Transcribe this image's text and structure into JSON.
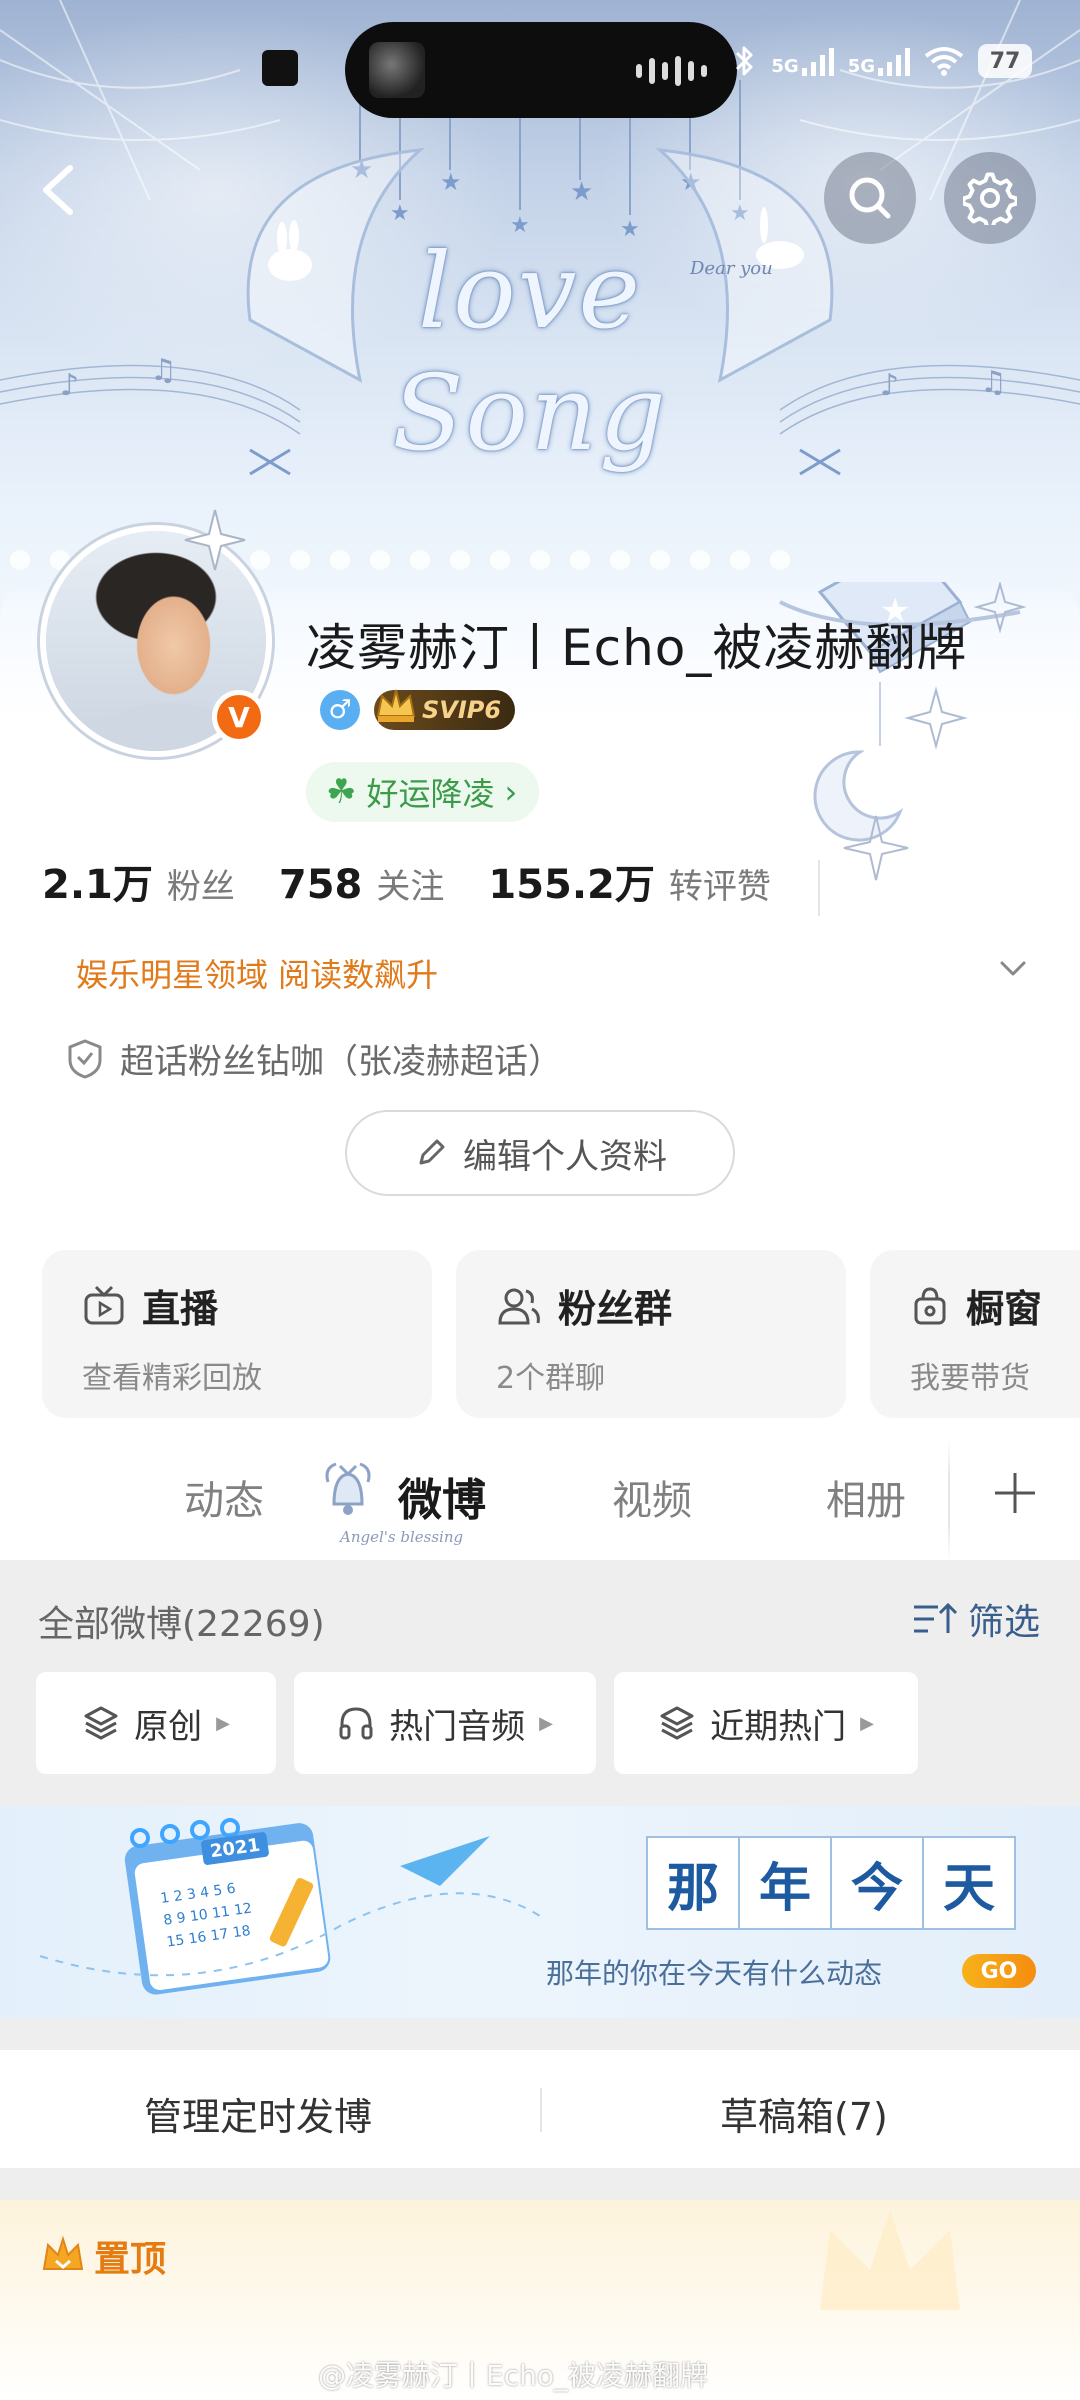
{
  "status_bar": {
    "network_1": "5G",
    "network_2": "5G",
    "battery": "77"
  },
  "header": {
    "banner_title": "love Song",
    "banner_small_text": "Dear you",
    "back_icon": "back-arrow-icon",
    "search_icon": "search-icon",
    "settings_icon": "gear-icon"
  },
  "profile": {
    "username": "凌雾赫汀丨Echo_被凌赫翻牌",
    "verified_badge": "V",
    "gender_symbol": "♂",
    "vip_label": "SVIP6",
    "lucky_label": "好运降凌",
    "lucky_chevron": "›",
    "stats": [
      {
        "value": "2.1万",
        "label": "粉丝"
      },
      {
        "value": "758",
        "label": "关注"
      },
      {
        "value": "155.2万",
        "label": "转评赞"
      }
    ],
    "domain_text": "娱乐明星领域 阅读数飙升",
    "fan_title": "超话粉丝钻咖（张凌赫超话）",
    "edit_button": "编辑个人资料"
  },
  "features": [
    {
      "title": "直播",
      "subtitle": "查看精彩回放",
      "icon": "tv-icon"
    },
    {
      "title": "粉丝群",
      "subtitle": "2个群聊",
      "icon": "group-icon"
    },
    {
      "title": "橱窗",
      "subtitle": "我要带货",
      "icon": "bag-icon"
    }
  ],
  "tabs": {
    "items": [
      "动态",
      "微博",
      "视频",
      "相册"
    ],
    "active": "微博",
    "active_caption": "Angel's blessing"
  },
  "feed": {
    "all_label": "全部微博(22269)",
    "filter_label": "筛选",
    "chips": [
      {
        "label": "原创",
        "icon": "layers-icon"
      },
      {
        "label": "热门音频",
        "icon": "headphones-icon"
      },
      {
        "label": "近期热门",
        "icon": "layers-icon"
      }
    ],
    "memory": {
      "year": "2021",
      "chars": [
        "那",
        "年",
        "今",
        "天"
      ],
      "subtitle": "那年的你在今天有什么动态",
      "go": "GO"
    },
    "manage_left": "管理定时发博",
    "manage_right": "草稿箱(7)",
    "pinned_label": "置顶"
  },
  "watermark": "@凌雾赫汀丨Echo_被凌赫翻牌"
}
